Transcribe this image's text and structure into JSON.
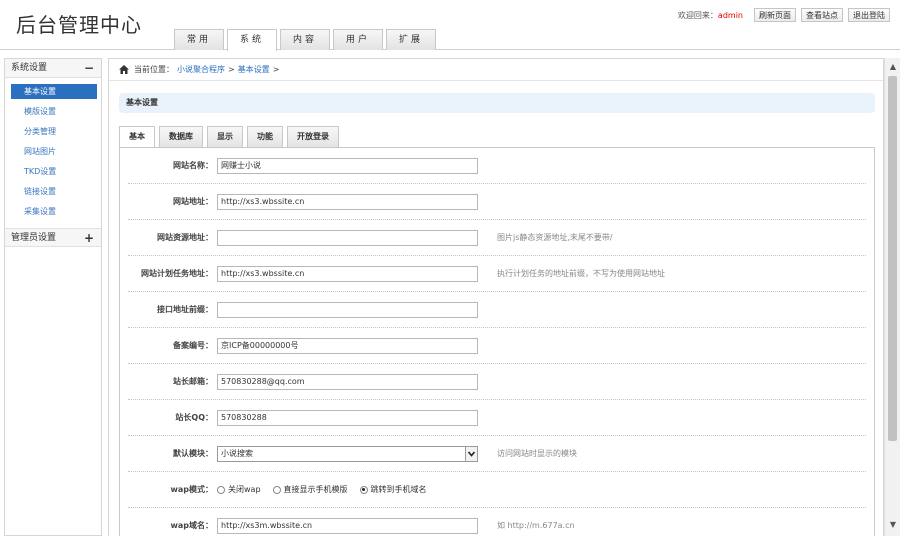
{
  "header": {
    "logo": "后台管理中心",
    "tabs": [
      {
        "label": "常用"
      },
      {
        "label": "系统"
      },
      {
        "label": "内容"
      },
      {
        "label": "用户"
      },
      {
        "label": "扩展"
      }
    ],
    "welcome_prefix": "欢迎回来：",
    "username": "admin",
    "buttons": [
      "刷新页面",
      "查看站点",
      "退出登陆"
    ]
  },
  "sidebar": {
    "group1_title": "系统设置",
    "group1_toggle": "−",
    "items": [
      {
        "label": "基本设置"
      },
      {
        "label": "模版设置"
      },
      {
        "label": "分类管理"
      },
      {
        "label": "网站图片"
      },
      {
        "label": "TKD设置"
      },
      {
        "label": "链接设置"
      },
      {
        "label": "采集设置"
      }
    ],
    "group2_title": "管理员设置",
    "group2_toggle": "+"
  },
  "breadcrumb": {
    "prefix": "当前位置：",
    "link1": "小说聚合程序",
    "sep1": ">",
    "link2": "基本设置",
    "sep2": ">"
  },
  "section_title": "基本设置",
  "tabs": [
    {
      "label": "基本"
    },
    {
      "label": "数据库"
    },
    {
      "label": "显示"
    },
    {
      "label": "功能"
    },
    {
      "label": "开放登录"
    }
  ],
  "form": {
    "site_name": {
      "label": "网站名称：",
      "value": "网赚士小说"
    },
    "site_url": {
      "label": "网站地址：",
      "value": "http://xs3.wbssite.cn"
    },
    "resource_url": {
      "label": "网站资源地址：",
      "value": "",
      "hint": "图片js静态资源地址,末尾不要带/"
    },
    "cron_url": {
      "label": "网站计划任务地址：",
      "value": "http://xs3.wbssite.cn",
      "hint": "执行计划任务的地址前缀，不写为使用网站地址"
    },
    "api_prefix": {
      "label": "接口地址前缀：",
      "value": ""
    },
    "icp": {
      "label": "备案编号：",
      "value": "京ICP备00000000号"
    },
    "email": {
      "label": "站长邮箱：",
      "value": "570830288@qq.com"
    },
    "qq": {
      "label": "站长QQ：",
      "value": "570830288"
    },
    "template": {
      "label": "默认模块：",
      "value": "小说搜索",
      "hint": "访问网站时显示的模块"
    },
    "wap_mode": {
      "label": "wap模式：",
      "options": [
        {
          "label": "关闭wap",
          "checked": false
        },
        {
          "label": "直接显示手机模版",
          "checked": false
        },
        {
          "label": "跳转到手机域名",
          "checked": true
        }
      ]
    },
    "wap_domain": {
      "label": "wap域名：",
      "value": "http://xs3m.wbssite.cn",
      "hint": "如 http://m.677a.cn"
    }
  },
  "scrollbar": {
    "up": "▲",
    "down": "▼"
  }
}
